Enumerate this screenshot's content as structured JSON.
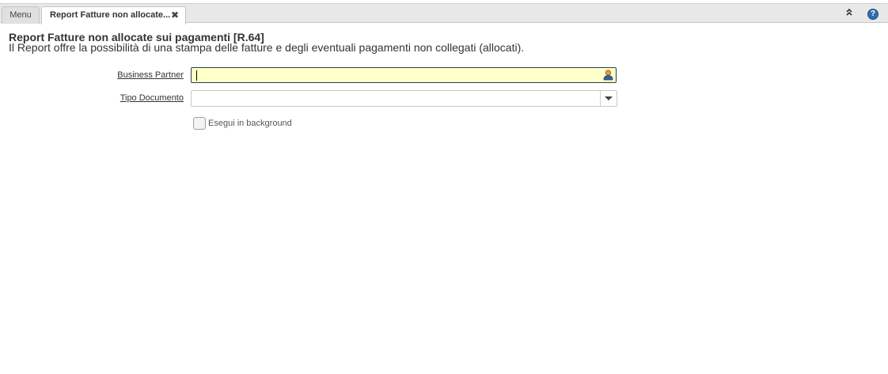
{
  "tabs": {
    "menu_label": "Menu",
    "report_label": "Report Fatture non allocate...",
    "close_symbol": "✖"
  },
  "toolbar": {
    "collapse_icon": "chevron-double-up-icon",
    "collapse_symbol": "»",
    "help_icon": "help-icon",
    "help_symbol": "?"
  },
  "header": {
    "title": "Report Fatture non allocate sui pagamenti [R.64]",
    "description": "Il Report offre la possibilità di una stampa delle fatture e degli eventuali pagamenti non collegati (allocati)."
  },
  "form": {
    "business_partner": {
      "label": "Business Partner",
      "value": "",
      "icon": "business-partner-lookup-icon"
    },
    "tipo_documento": {
      "label": "Tipo Documento",
      "value": ""
    },
    "background": {
      "label": "Esegui in background",
      "checked": false
    }
  },
  "colors": {
    "active_field_bg": "#ffffc8",
    "help_blue": "#2f6fb0"
  }
}
